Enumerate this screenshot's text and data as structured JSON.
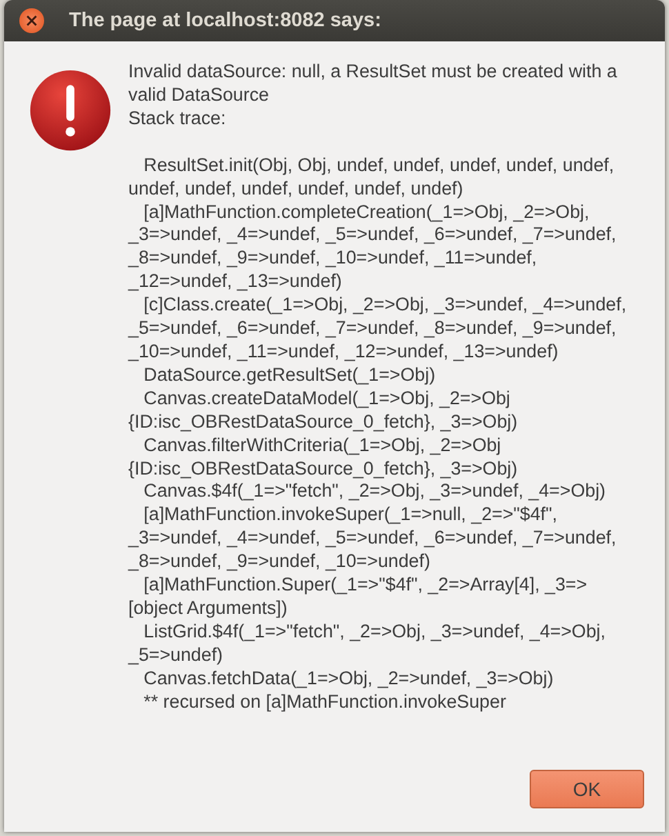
{
  "window": {
    "title": "The page at localhost:8082 says:"
  },
  "message_lines": [
    "Invalid dataSource: null, a ResultSet must be created with a",
    "valid DataSource",
    "Stack trace:"
  ],
  "trace_lines": [
    "   ResultSet.init(Obj, Obj, undef, undef, undef, undef, undef,",
    "undef, undef, undef, undef, undef, undef)",
    "   [a]MathFunction.completeCreation(_1=>Obj, _2=>Obj,",
    "_3=>undef, _4=>undef, _5=>undef, _6=>undef, _7=>undef,",
    "_8=>undef, _9=>undef, _10=>undef, _11=>undef,",
    "_12=>undef, _13=>undef)",
    "   [c]Class.create(_1=>Obj, _2=>Obj, _3=>undef, _4=>undef,",
    "_5=>undef, _6=>undef, _7=>undef, _8=>undef, _9=>undef,",
    "_10=>undef, _11=>undef, _12=>undef, _13=>undef)",
    "   DataSource.getResultSet(_1=>Obj)",
    "   Canvas.createDataModel(_1=>Obj, _2=>Obj",
    "{ID:isc_OBRestDataSource_0_fetch}, _3=>Obj)",
    "   Canvas.filterWithCriteria(_1=>Obj, _2=>Obj",
    "{ID:isc_OBRestDataSource_0_fetch}, _3=>Obj)",
    "   Canvas.$4f(_1=>\"fetch\", _2=>Obj, _3=>undef, _4=>Obj)",
    "   [a]MathFunction.invokeSuper(_1=>null, _2=>\"$4f\",",
    "_3=>undef, _4=>undef, _5=>undef, _6=>undef, _7=>undef,",
    "_8=>undef, _9=>undef, _10=>undef)",
    "   [a]MathFunction.Super(_1=>\"$4f\", _2=>Array[4], _3=>",
    "[object Arguments])",
    "   ListGrid.$4f(_1=>\"fetch\", _2=>Obj, _3=>undef, _4=>Obj,",
    "_5=>undef)",
    "   Canvas.fetchData(_1=>Obj, _2=>undef, _3=>Obj)",
    "   ** recursed on [a]MathFunction.invokeSuper"
  ],
  "buttons": [
    {
      "label": "OK",
      "default": true
    }
  ]
}
